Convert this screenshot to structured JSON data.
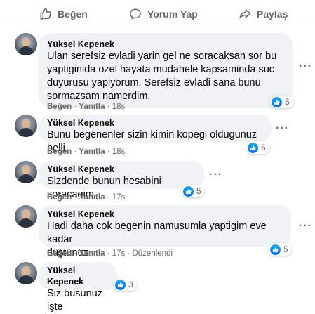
{
  "actions": {
    "like_label": "Beğen",
    "comment_label": "Yorum Yap",
    "share_label": "Paylaş"
  },
  "comments": [
    {
      "author": "Yüksel Kepenek",
      "text_lines": [
        "Ulan serefsiz evladi yarin gel ne soracaksan sor bu",
        "yaptiginida ozel hayata mudahele kapsaminda suc",
        "duyurusu yapiyorum. Serefsiz evladi sana bunu",
        "sormazsam namerdim."
      ],
      "like_action": "Beğen",
      "reply_action": "Yanıtla",
      "time": "18s",
      "reactions": "5"
    },
    {
      "author": "Yüksel Kepenek",
      "text_lines": [
        "Bunu begenenler sizin kimin kopegi oldugunuz belli"
      ],
      "like_action": "Beğen",
      "reply_action": "Yanıtla",
      "time": "18s",
      "reactions": "5"
    },
    {
      "author": "Yüksel Kepenek",
      "text_lines": [
        "Sizdende bunun hesabini soracagim"
      ],
      "like_action": "Beğen",
      "reply_action": "Yanıtla",
      "time": "17s",
      "reactions": "5"
    },
    {
      "author": "Yüksel Kepenek",
      "text_lines": [
        "Hadi daha cok begenin namusumla yaptigim eve kadar",
        "düştünüz"
      ],
      "like_action": "Beğen",
      "reply_action": "Yanıtla",
      "time": "17s",
      "edited": "Düzenlendi",
      "reactions": "5"
    },
    {
      "author": "Yüksel Kepenek",
      "text_lines": [
        "Siz busunuz işte"
      ],
      "reactions": "3"
    }
  ],
  "colors": {
    "bubble": "#f0f2f5",
    "meta": "#65676b",
    "like_blue": "#1877f2"
  }
}
